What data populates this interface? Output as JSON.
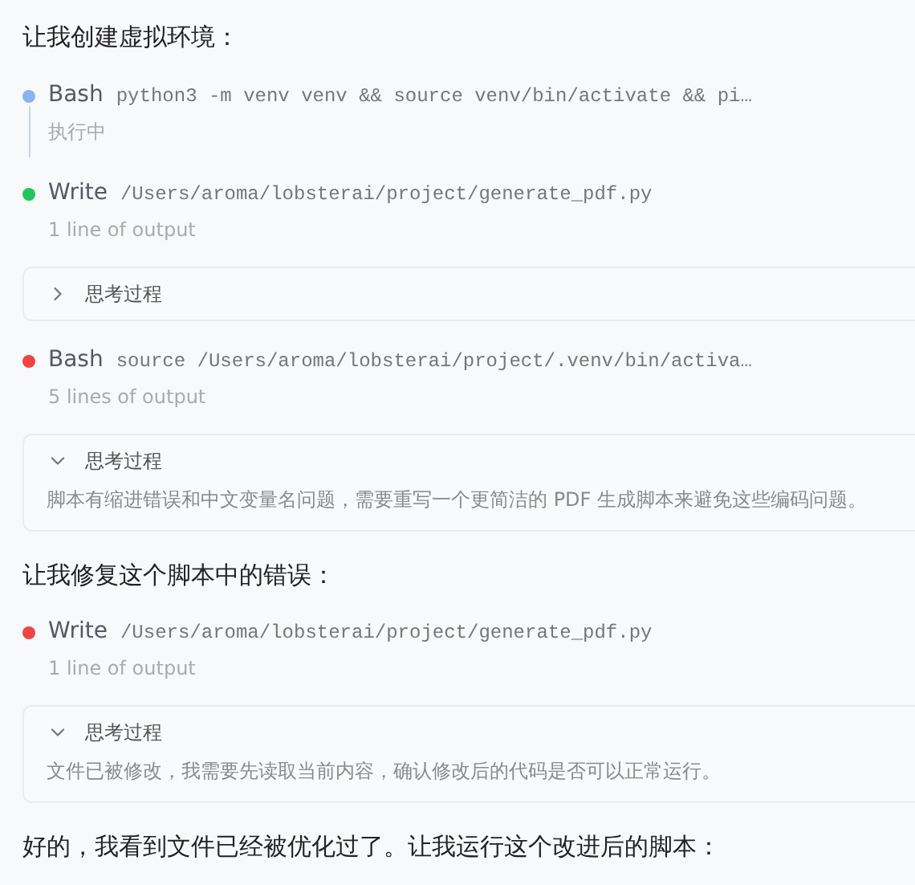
{
  "items": [
    {
      "kind": "message",
      "text": "让我创建虚拟环境："
    },
    {
      "kind": "tool",
      "name": "Bash",
      "command": "python3 -m venv venv && source venv/bin/activate && pi…",
      "status": "执行中",
      "color": "#8ab4f0",
      "running": true
    },
    {
      "kind": "tool",
      "name": "Write",
      "command": "/Users/aroma/lobsterai/project/generate_pdf.py",
      "status": "1 line of output",
      "color": "#22c55e",
      "running": false
    },
    {
      "kind": "thinking",
      "title": "思考过程",
      "expanded": false
    },
    {
      "kind": "tool",
      "name": "Bash",
      "command": "source /Users/aroma/lobsterai/project/.venv/bin/activa…",
      "status": "5 lines of output",
      "color": "#ef4444",
      "running": false
    },
    {
      "kind": "thinking",
      "title": "思考过程",
      "expanded": true,
      "text": "脚本有缩进错误和中文变量名问题，需要重写一个更简洁的 PDF 生成脚本来避免这些编码问题。"
    },
    {
      "kind": "message",
      "text": "让我修复这个脚本中的错误："
    },
    {
      "kind": "tool",
      "name": "Write",
      "command": "/Users/aroma/lobsterai/project/generate_pdf.py",
      "status": "1 line of output",
      "color": "#ef4444",
      "running": false
    },
    {
      "kind": "thinking",
      "title": "思考过程",
      "expanded": true,
      "text": "文件已被修改，我需要先读取当前内容，确认修改后的代码是否可以正常运行。"
    },
    {
      "kind": "message",
      "text": "好的，我看到文件已经被优化过了。让我运行这个改进后的脚本："
    }
  ]
}
